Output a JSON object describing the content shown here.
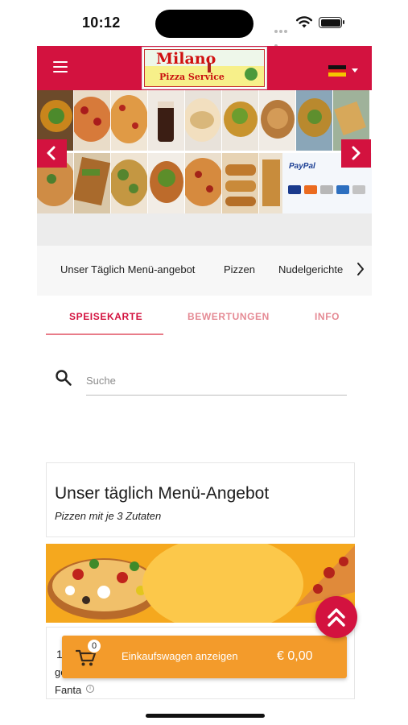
{
  "status_bar": {
    "time": "10:12"
  },
  "header": {
    "logo_name": "Milano",
    "logo_sub": "Pizza Service",
    "menu_icon": "hamburger-icon",
    "language_flag": "germany-flag-icon"
  },
  "gallery": {
    "payment_text": "PayPal",
    "prev_icon": "chevron-left-icon",
    "next_icon": "chevron-right-icon"
  },
  "categories": {
    "items": [
      "Unser Täglich Menü-angebot",
      "Pizzen",
      "Nudelgerichte F"
    ],
    "next_icon": "chevron-right-icon"
  },
  "tabs": {
    "items": [
      "SPEISEKARTE",
      "BEWERTUNGEN",
      "INFO"
    ],
    "active": "SPEISEKARTE"
  },
  "search": {
    "placeholder": "Suche",
    "value": ""
  },
  "section": {
    "title": "Unser täglich Menü-Angebot",
    "subtitle": "Pizzen mit je 3 Zutaten"
  },
  "item": {
    "number": "1",
    "fragment": "ge",
    "name": "Fanta"
  },
  "cart": {
    "count": "0",
    "label": "Einkaufswagen anzeigen",
    "total": "€ 0,00"
  },
  "colors": {
    "brand_red": "#d3123f",
    "cart_orange": "#f39b2b",
    "tab_inactive": "#e58a94"
  }
}
